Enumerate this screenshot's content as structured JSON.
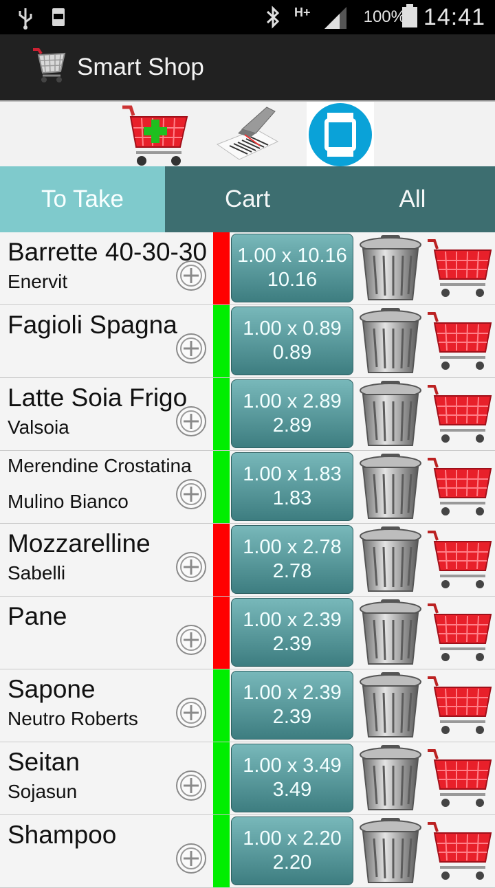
{
  "status_bar": {
    "battery_percent": "100%",
    "time": "14:41",
    "network_type": "H+"
  },
  "action_bar": {
    "title": "Smart Shop",
    "icon": "shopping-cart-icon"
  },
  "toolbar": {
    "buttons": [
      {
        "icon": "add-to-cart-icon"
      },
      {
        "icon": "barcode-scanner-icon"
      },
      {
        "icon": "smartwatch-icon"
      }
    ]
  },
  "tabs": [
    {
      "label": "To Take",
      "active": true
    },
    {
      "label": "Cart",
      "active": false
    },
    {
      "label": "All",
      "active": false
    }
  ],
  "items": [
    {
      "name": "Barrette 40-30-30",
      "brand": "Enervit",
      "qty_price": "1.00 x 10.16",
      "total": "10.16",
      "status_color": "#ff0000"
    },
    {
      "name": "Fagioli Spagna",
      "brand": "",
      "qty_price": "1.00 x 0.89",
      "total": "0.89",
      "status_color": "#00ee00"
    },
    {
      "name": "Latte Soia Frigo",
      "brand": "Valsoia",
      "qty_price": "1.00 x 2.89",
      "total": "2.89",
      "status_color": "#00ee00"
    },
    {
      "name": "Merendine Crostatina",
      "brand": "Mulino Bianco",
      "qty_price": "1.00 x 1.83",
      "total": "1.83",
      "status_color": "#00ee00"
    },
    {
      "name": "Mozzarelline",
      "brand": "Sabelli",
      "qty_price": "1.00 x 2.78",
      "total": "2.78",
      "status_color": "#ff0000"
    },
    {
      "name": "Pane",
      "brand": "",
      "qty_price": "1.00 x 2.39",
      "total": "2.39",
      "status_color": "#ff0000"
    },
    {
      "name": "Sapone",
      "brand": "Neutro Roberts",
      "qty_price": "1.00 x 2.39",
      "total": "2.39",
      "status_color": "#00ee00"
    },
    {
      "name": "Seitan",
      "brand": "Sojasun",
      "qty_price": "1.00 x 3.49",
      "total": "3.49",
      "status_color": "#00ee00"
    },
    {
      "name": "Shampoo",
      "brand": "",
      "qty_price": "1.00 x 2.20",
      "total": "2.20",
      "status_color": "#00ee00"
    }
  ]
}
